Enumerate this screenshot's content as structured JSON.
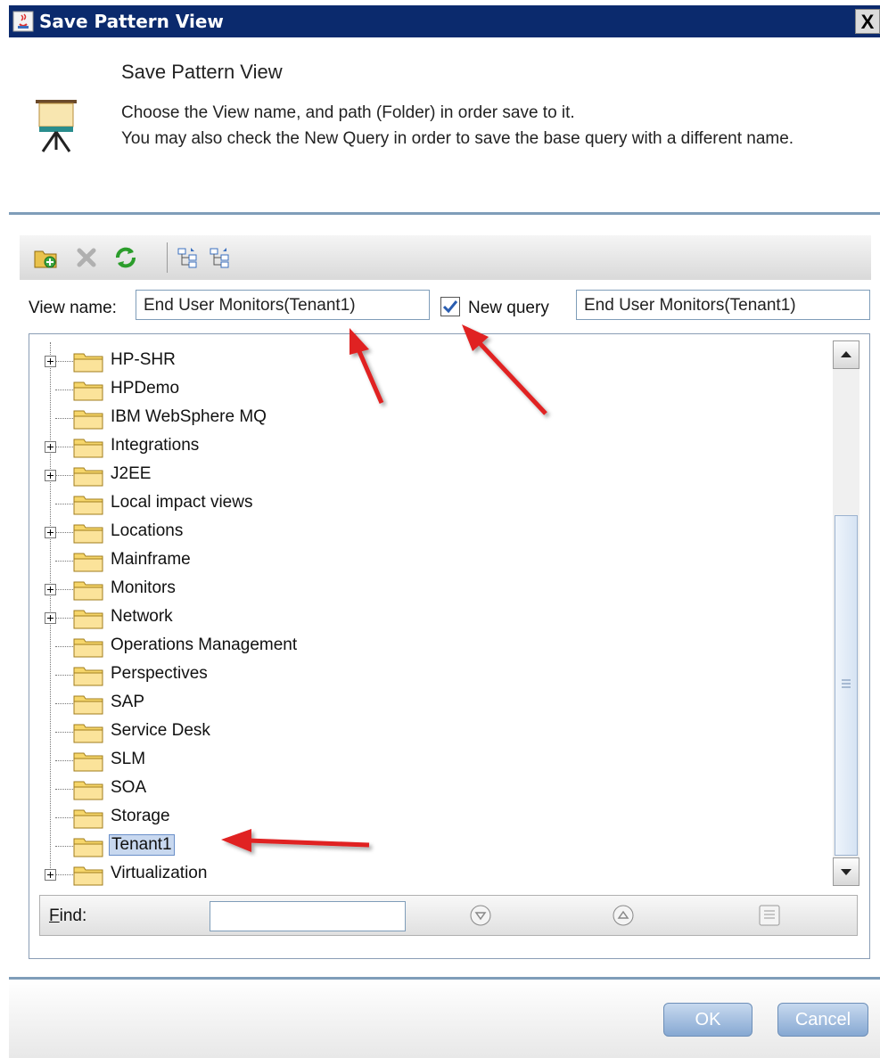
{
  "window": {
    "title": "Save Pattern View",
    "close_label": "X"
  },
  "header": {
    "title": "Save Pattern View",
    "description_line1": "Choose the View name, and path (Folder) in order save to it.",
    "description_line2": "You may also check the New Query in order to save the base query with a different name."
  },
  "toolbar": {
    "buttons": [
      "new-folder-icon",
      "delete-icon",
      "refresh-icon",
      "expand-all-icon",
      "collapse-all-icon"
    ]
  },
  "form": {
    "view_name_label": "View name:",
    "view_name_value": "End User Monitors(Tenant1)",
    "new_query_label": "New query",
    "new_query_checked": true,
    "new_query_value": "End User Monitors(Tenant1)"
  },
  "tree": {
    "items": [
      {
        "label": "HP-SHR",
        "expandable": true
      },
      {
        "label": "HPDemo",
        "expandable": false
      },
      {
        "label": "IBM WebSphere MQ",
        "expandable": false
      },
      {
        "label": "Integrations",
        "expandable": true
      },
      {
        "label": "J2EE",
        "expandable": true
      },
      {
        "label": "Local impact views",
        "expandable": false
      },
      {
        "label": "Locations",
        "expandable": true
      },
      {
        "label": "Mainframe",
        "expandable": false
      },
      {
        "label": "Monitors",
        "expandable": true
      },
      {
        "label": "Network",
        "expandable": true
      },
      {
        "label": "Operations Management",
        "expandable": false
      },
      {
        "label": "Perspectives",
        "expandable": false
      },
      {
        "label": "SAP",
        "expandable": false
      },
      {
        "label": "Service Desk",
        "expandable": false
      },
      {
        "label": "SLM",
        "expandable": false
      },
      {
        "label": "SOA",
        "expandable": false
      },
      {
        "label": "Storage",
        "expandable": false
      },
      {
        "label": "Tenant1",
        "expandable": false,
        "selected": true
      },
      {
        "label": "Virtualization",
        "expandable": true
      }
    ]
  },
  "find": {
    "label": "Find:",
    "value": "",
    "next_icon": "find-next-icon",
    "prev_icon": "find-previous-icon",
    "options_icon": "find-options-icon"
  },
  "footer": {
    "ok_label": "OK",
    "cancel_label": "Cancel"
  },
  "colors": {
    "titlebar": "#0b2a6d",
    "annotation_arrow": "#e02020",
    "selection": "#c8d8ef"
  }
}
